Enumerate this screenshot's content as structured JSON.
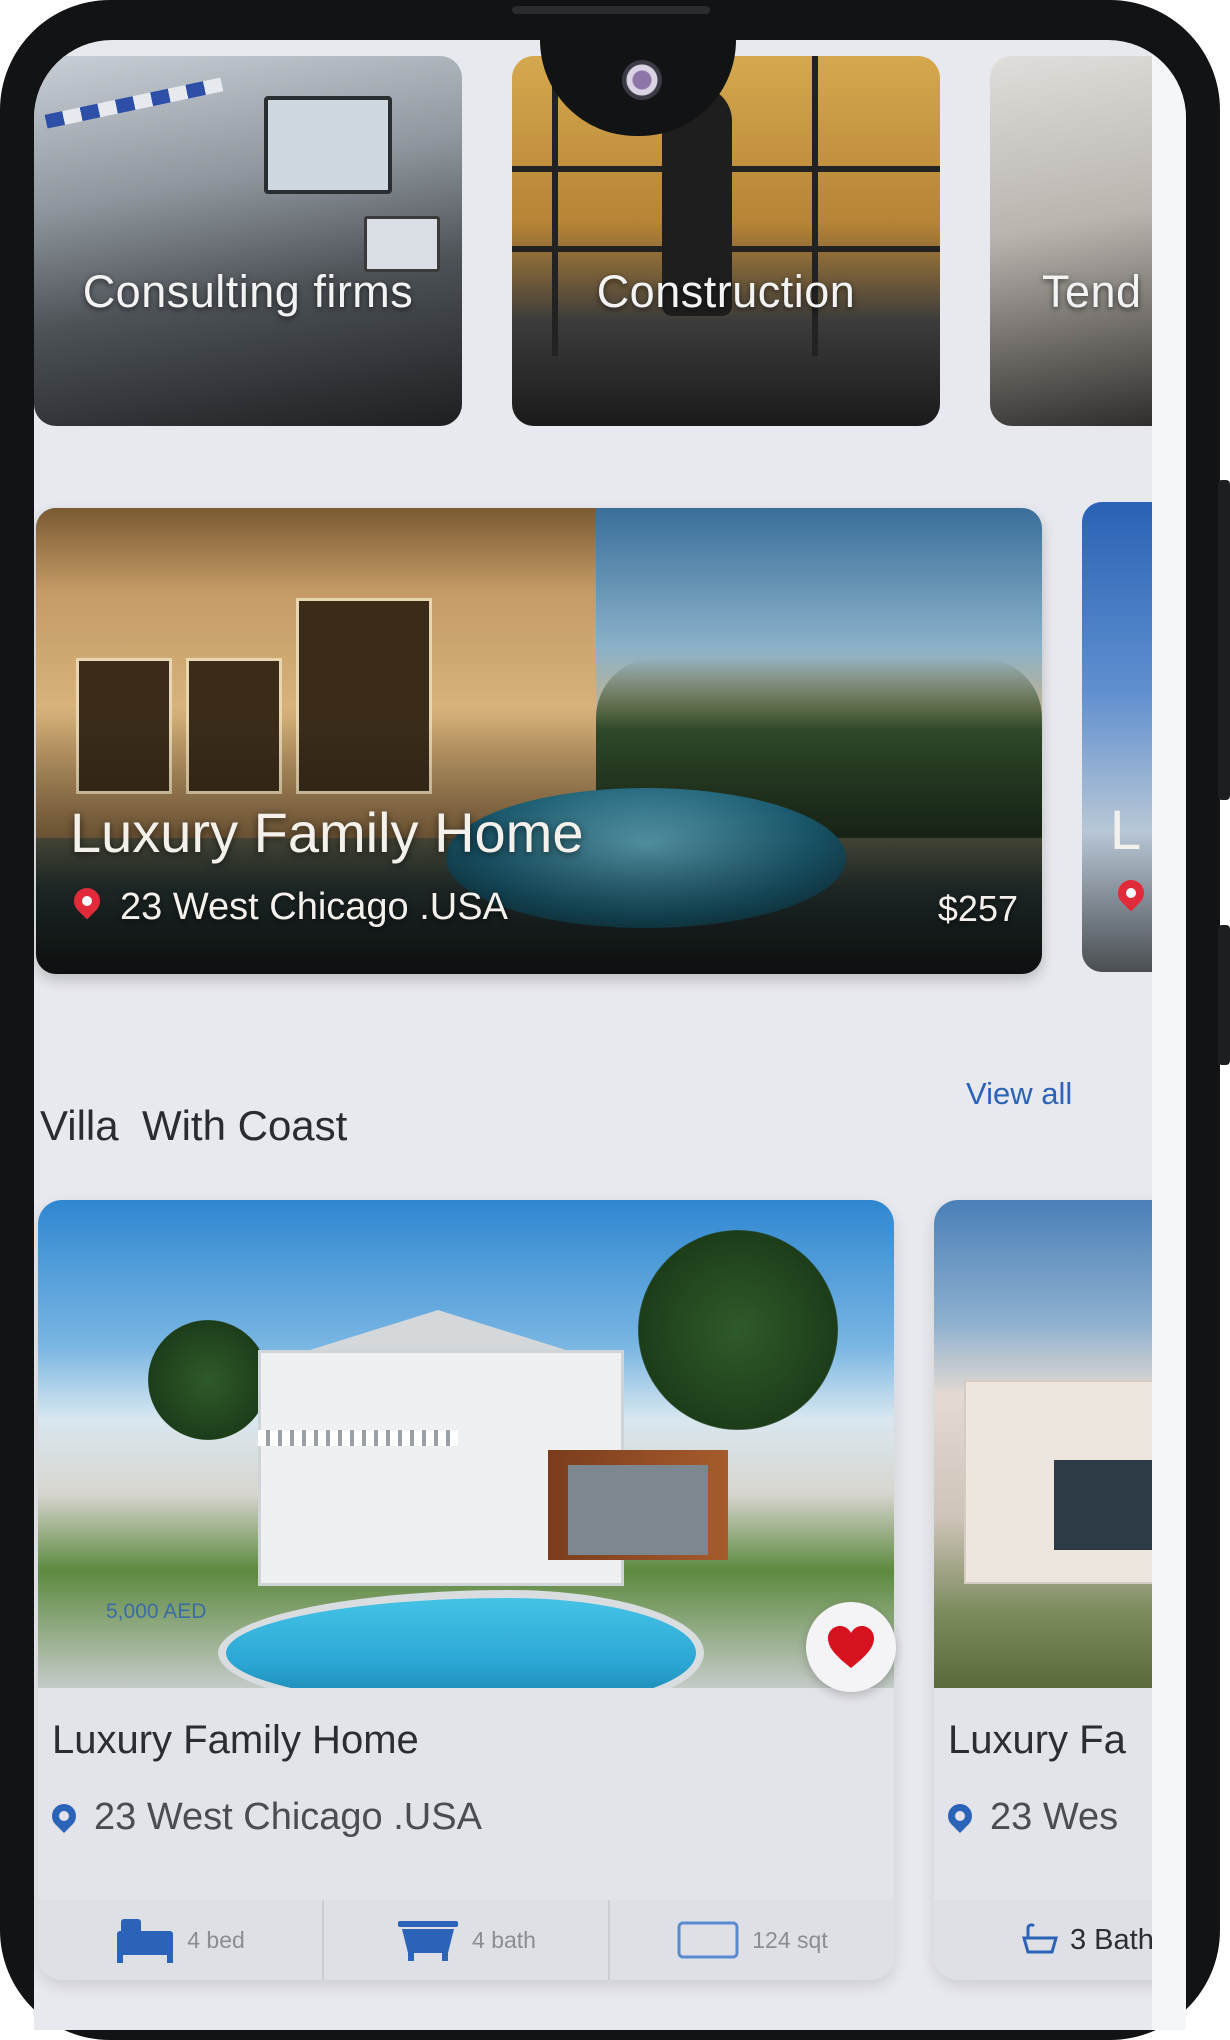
{
  "categories": [
    {
      "label": "Consulting firms"
    },
    {
      "label": "Construction"
    },
    {
      "label": "Tend"
    }
  ],
  "featured": {
    "title": "Luxury Family Home",
    "address": "23 West Chicago .USA",
    "price": "$257",
    "peek_title": "L"
  },
  "section": {
    "title": "Villa  With Coast",
    "view_all": "View all"
  },
  "listings": [
    {
      "title": "Luxury Family Home",
      "address": "23 West Chicago .USA",
      "price_tag": "5,000 AED",
      "favorite": true,
      "bed": "4 bed",
      "bath": "4 bath",
      "area": "124 sqt"
    },
    {
      "title": "Luxury Fa",
      "address": "23 Wes",
      "bath": "3 Bath"
    }
  ],
  "colors": {
    "accent": "#2b63b9",
    "heart": "#d7121f",
    "background": "#e8e9ee",
    "frame": "#121314"
  }
}
